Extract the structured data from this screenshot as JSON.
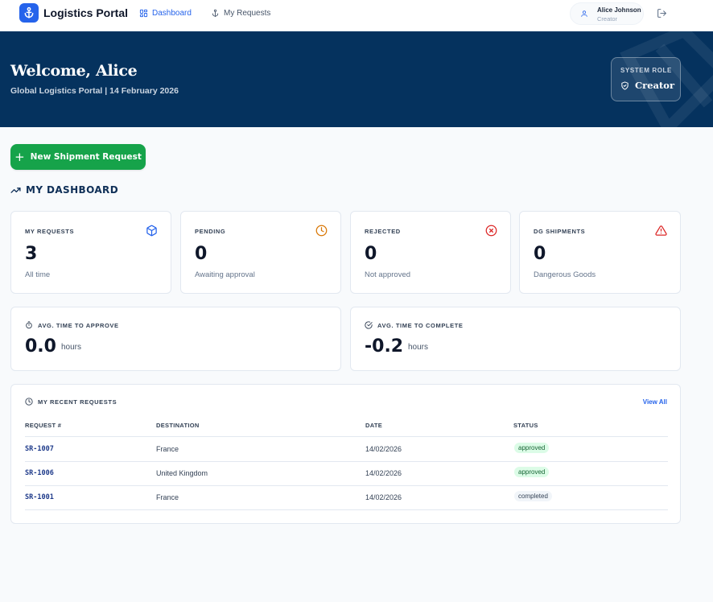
{
  "nav": {
    "app_name": "Logistics Portal",
    "links": [
      {
        "label": "Dashboard",
        "icon": "dashboard-grid-icon",
        "active": true
      },
      {
        "label": "My Requests",
        "icon": "anchor-icon",
        "active": false
      }
    ],
    "user": {
      "name": "Alice Johnson",
      "role": "Creator"
    }
  },
  "hero": {
    "title": "Welcome, Alice",
    "subtitle": "Global Logistics Portal | 14 February 2026",
    "role_label": "SYSTEM ROLE",
    "role_value": "Creator"
  },
  "actions": {
    "new_request": "New Shipment Request"
  },
  "dashboard": {
    "title": "MY DASHBOARD",
    "stats": [
      {
        "label": "MY REQUESTS",
        "value": "3",
        "sub": "All time",
        "icon": "package-icon",
        "color": "#2563eb"
      },
      {
        "label": "PENDING",
        "value": "0",
        "sub": "Awaiting approval",
        "icon": "clock-icon",
        "color": "#d97706"
      },
      {
        "label": "REJECTED",
        "value": "0",
        "sub": "Not approved",
        "icon": "x-circle-icon",
        "color": "#dc2626"
      },
      {
        "label": "DG SHIPMENTS",
        "value": "0",
        "sub": "Dangerous Goods",
        "icon": "warning-triangle-icon",
        "color": "#dc2626"
      }
    ],
    "times": [
      {
        "label": "AVG. TIME TO APPROVE",
        "value": "0.0",
        "unit": "hours",
        "icon": "stopwatch-icon"
      },
      {
        "label": "AVG. TIME TO COMPLETE",
        "value": "-0.2",
        "unit": "hours",
        "icon": "check-circle-icon"
      }
    ]
  },
  "recent": {
    "title": "MY RECENT REQUESTS",
    "view_all": "View All",
    "columns": [
      "REQUEST #",
      "DESTINATION",
      "DATE",
      "STATUS"
    ],
    "rows": [
      {
        "id": "SR-1007",
        "destination": "France",
        "date": "14/02/2026",
        "status": "approved"
      },
      {
        "id": "SR-1006",
        "destination": "United Kingdom",
        "date": "14/02/2026",
        "status": "approved"
      },
      {
        "id": "SR-1001",
        "destination": "France",
        "date": "14/02/2026",
        "status": "completed"
      }
    ]
  }
}
